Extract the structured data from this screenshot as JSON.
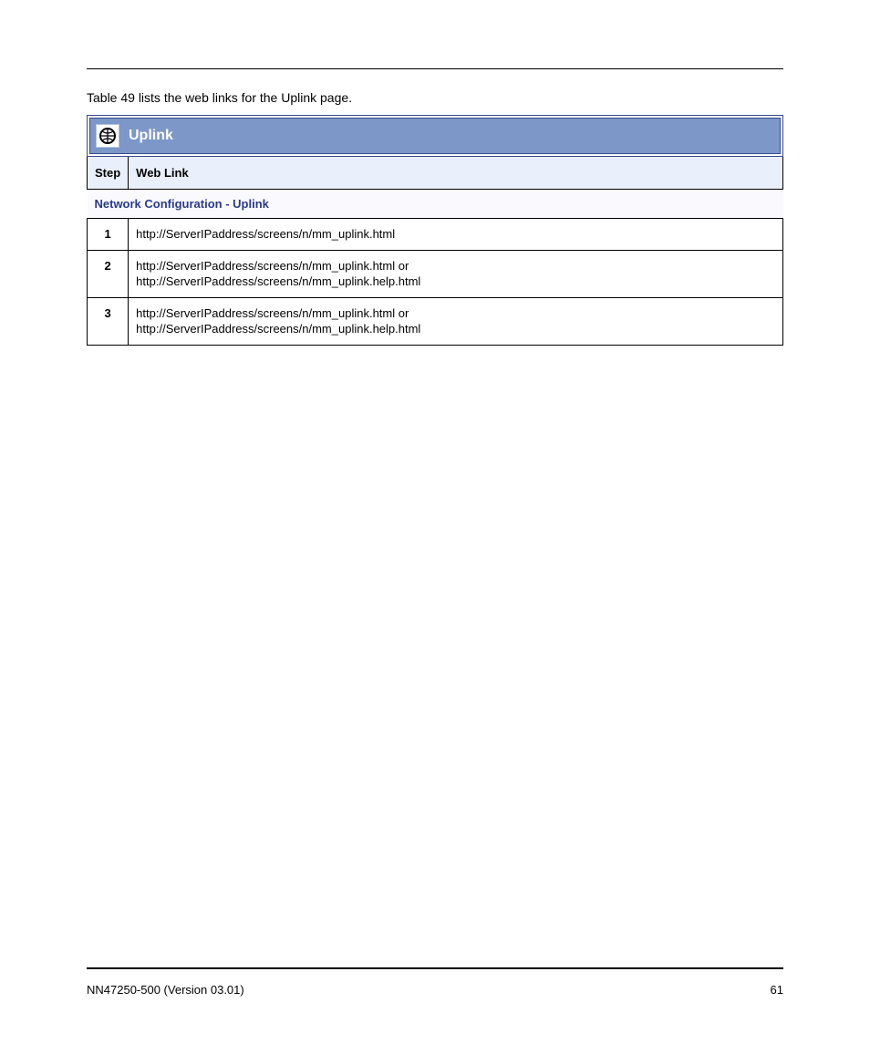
{
  "intro": "Table 49 lists the web links for the Uplink page.",
  "panel": {
    "title": "Uplink",
    "columns": {
      "step": "Step",
      "weblink": "Web Link"
    },
    "section": "Network Configuration - Uplink",
    "rows": [
      {
        "step": "1",
        "text": "http://ServerIPaddress/screens/n/mm_uplink.html"
      },
      {
        "step": "2",
        "text": "http://ServerIPaddress/screens/n/mm_uplink.html or\nhttp://ServerIPaddress/screens/n/mm_uplink.help.html"
      },
      {
        "step": "3",
        "text": "http://ServerIPaddress/screens/n/mm_uplink.html or\nhttp://ServerIPaddress/screens/n/mm_uplink.help.html"
      }
    ]
  },
  "footer": {
    "left": "NN47250-500 (Version 03.01)",
    "right": "61"
  }
}
